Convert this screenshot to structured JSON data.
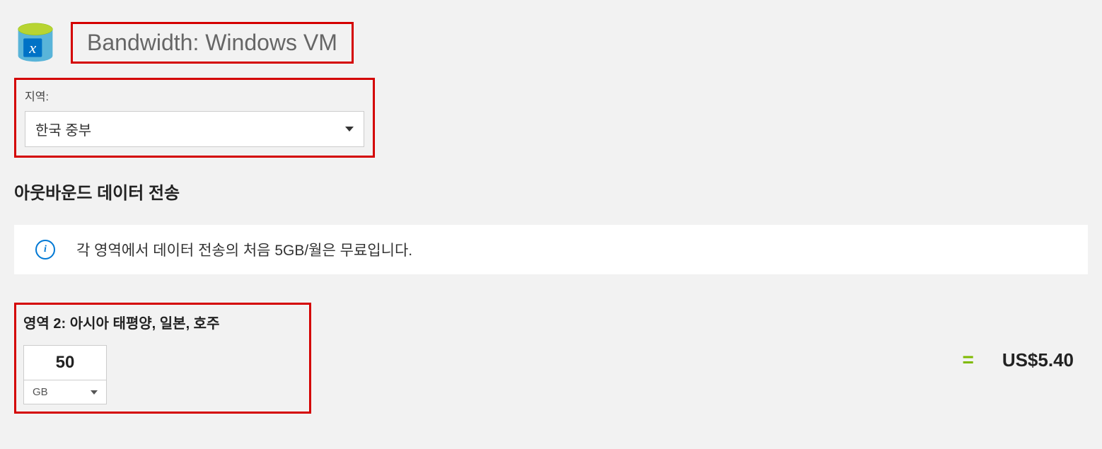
{
  "header": {
    "title": "Bandwidth: Windows VM",
    "icon": "function-x-cylinder-icon"
  },
  "region": {
    "label": "지역:",
    "selected": "한국 중부"
  },
  "section": {
    "title": "아웃바운드 데이터 전송"
  },
  "info": {
    "text": "각 영역에서 데이터 전송의 처음 5GB/월은 무료입니다."
  },
  "zone": {
    "title": "영역 2: 아시아 태평양, 일본, 호주",
    "amount": "50",
    "unit": "GB"
  },
  "result": {
    "equals": "=",
    "price": "US$5.40"
  }
}
